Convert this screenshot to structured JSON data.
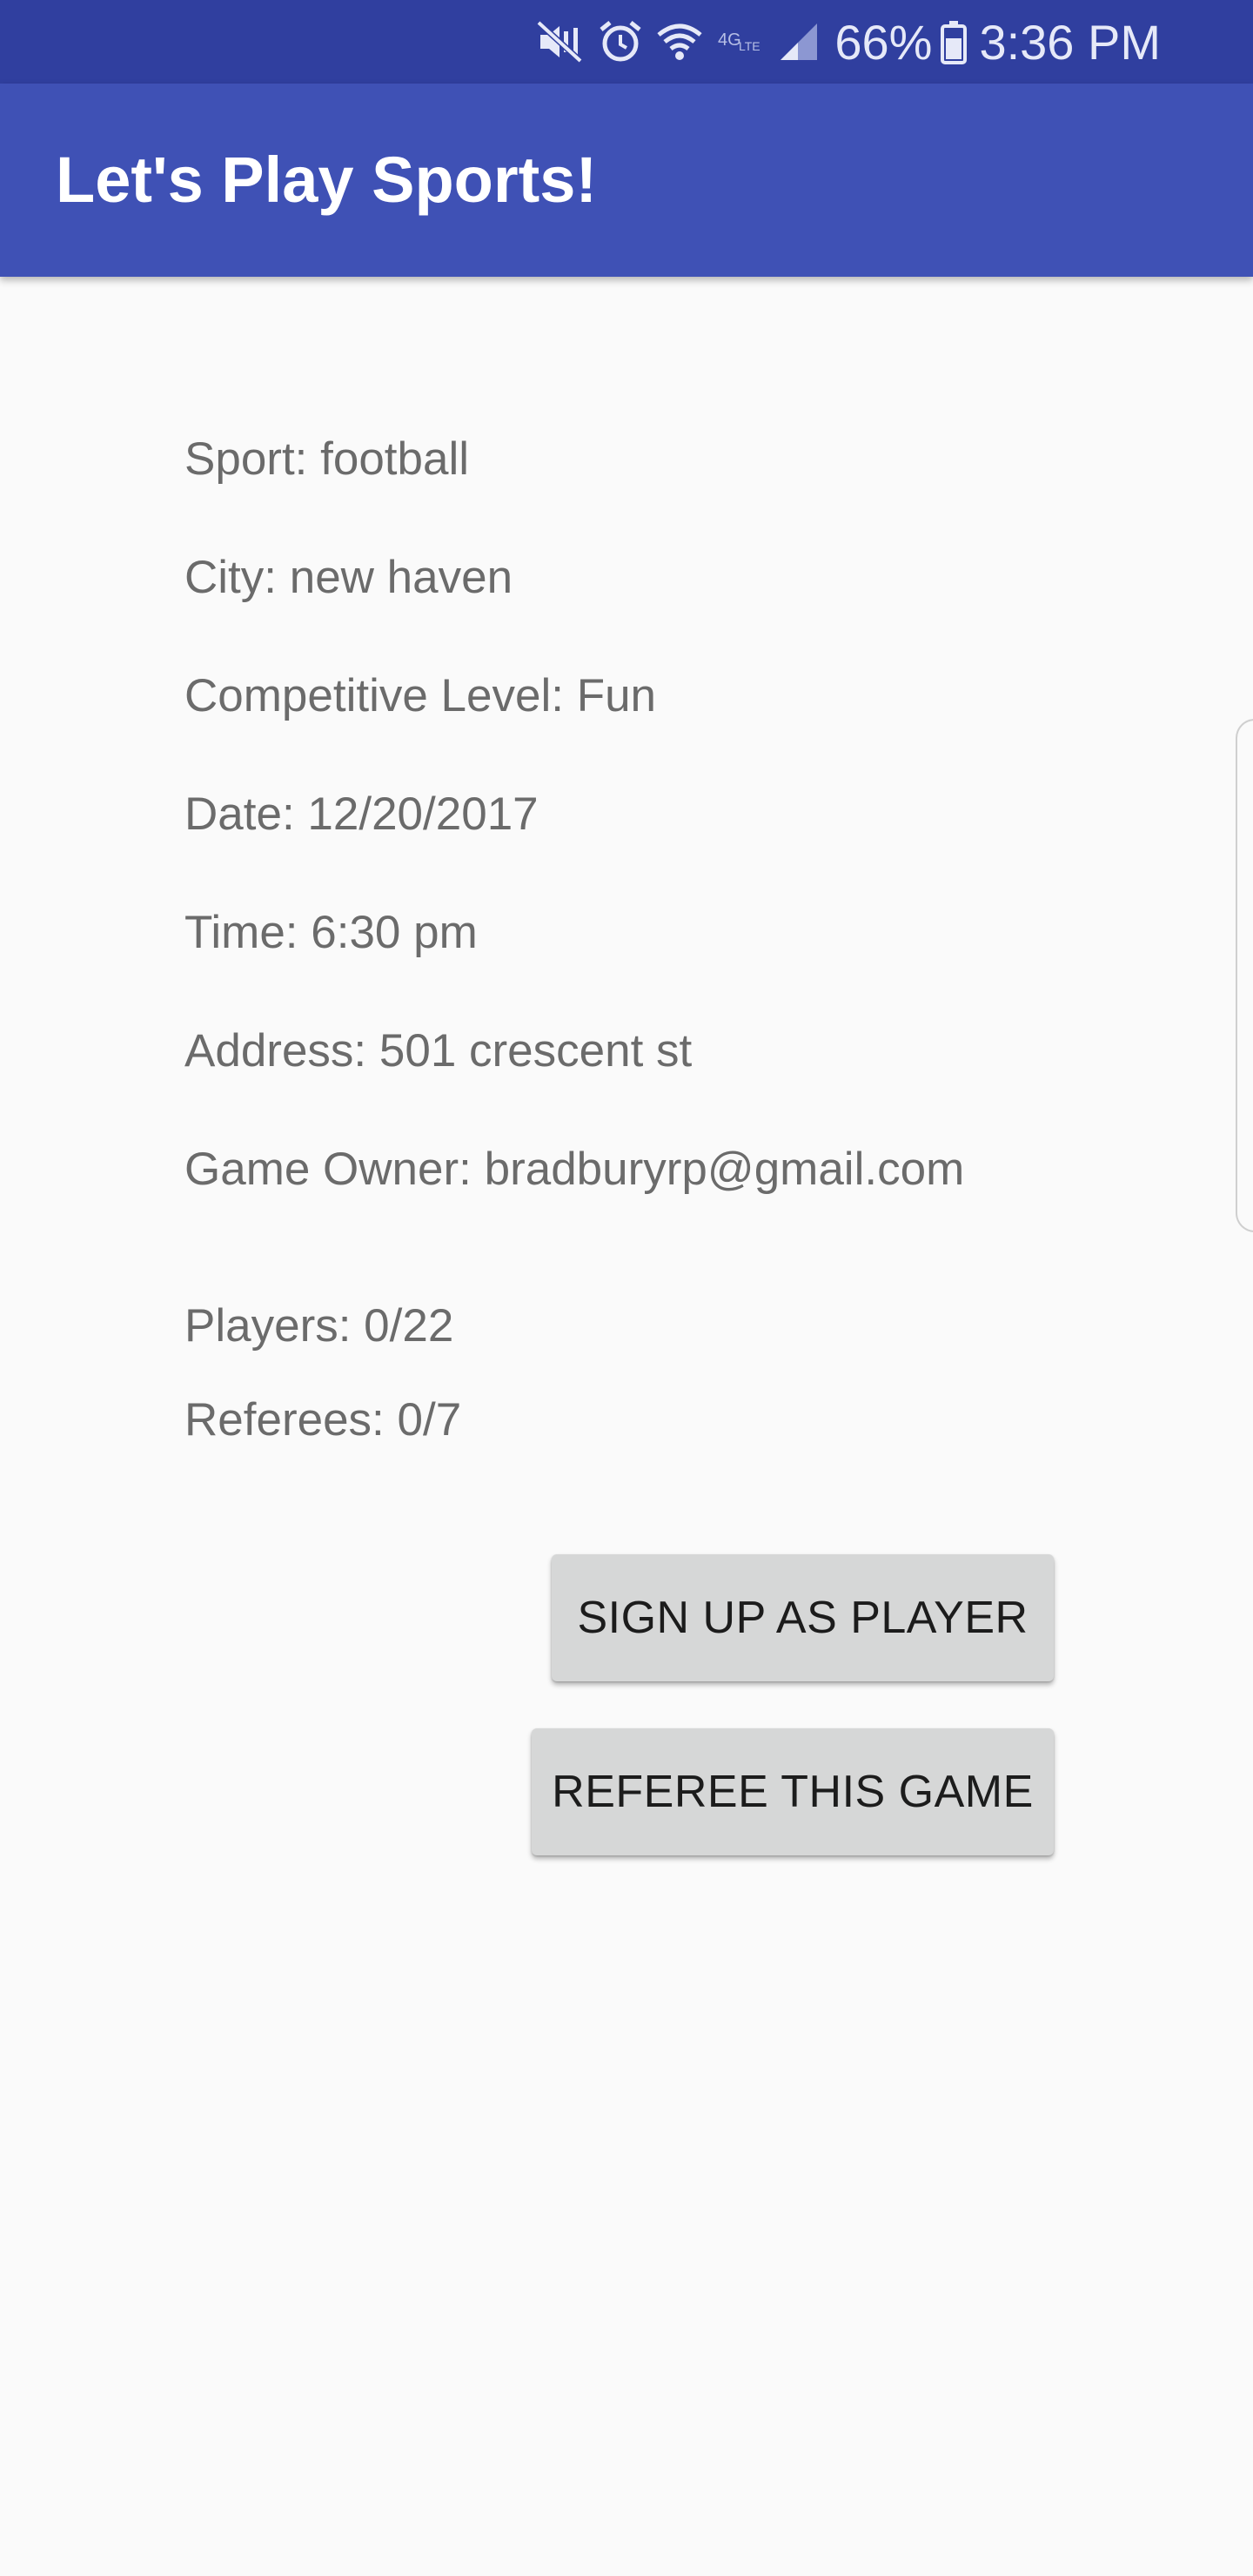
{
  "status_bar": {
    "icons": [
      "mute-vibrate-icon",
      "alarm-icon",
      "wifi-icon",
      "lte-icon",
      "signal-icon",
      "battery-icon"
    ],
    "battery_percent": "66%",
    "time": "3:36 PM",
    "background_color": "#303f9f"
  },
  "app_bar": {
    "title": "Let's Play Sports!",
    "background_color": "#3f51b5"
  },
  "game": {
    "sport": "Sport: football",
    "city": "City: new haven",
    "competitive_level": "Competitive Level: Fun",
    "date": "Date: 12/20/2017",
    "time": "Time: 6:30 pm",
    "address": "Address: 501 crescent st",
    "owner": "Game Owner: bradburyrp@gmail.com",
    "players": "Players: 0/22",
    "referees": "Referees: 0/7"
  },
  "actions": {
    "sign_up_player": "SIGN UP AS PLAYER",
    "referee_game": "REFEREE THIS GAME"
  }
}
